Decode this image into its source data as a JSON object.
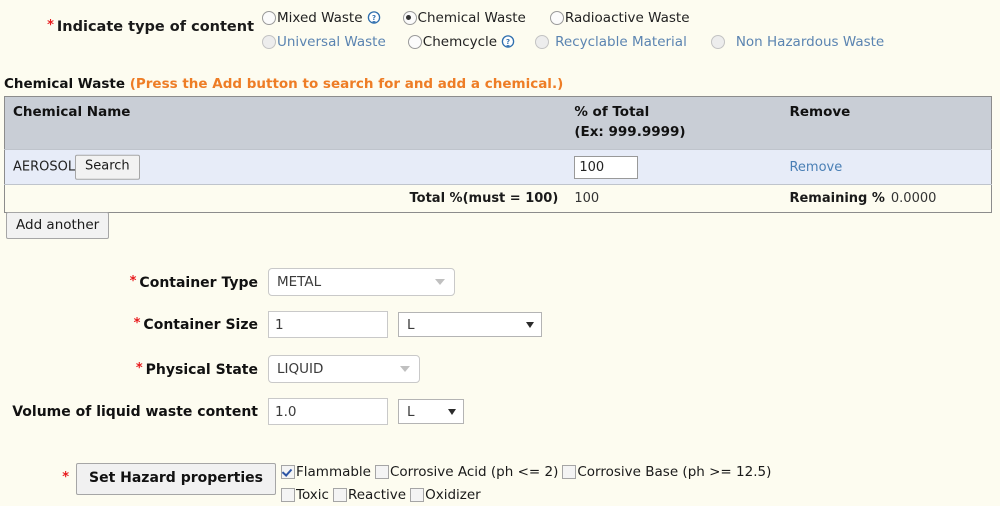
{
  "content_type": {
    "label": "Indicate type of content",
    "required": true,
    "options": [
      {
        "label": "Mixed Waste",
        "checked": false,
        "disabled": false,
        "help": true,
        "style": "normal"
      },
      {
        "label": "Chemical Waste",
        "checked": true,
        "disabled": false,
        "help": false,
        "style": "normal"
      },
      {
        "label": "Radioactive Waste",
        "checked": false,
        "disabled": false,
        "help": false,
        "style": "normal"
      },
      {
        "label": "Universal Waste",
        "checked": false,
        "disabled": true,
        "help": false,
        "style": "disabled"
      },
      {
        "label": "Chemcycle",
        "checked": false,
        "disabled": false,
        "help": true,
        "style": "normal"
      },
      {
        "label": "Recyclable Material",
        "checked": false,
        "disabled": true,
        "help": false,
        "style": "disabled"
      },
      {
        "label": "Non Hazardous Waste",
        "checked": false,
        "disabled": true,
        "help": false,
        "style": "disabled"
      }
    ]
  },
  "chemical_section": {
    "heading": "Chemical Waste",
    "hint": "(Press the Add button to search for and add a chemical.)",
    "columns": [
      "Chemical Name",
      "% of Total",
      "(Ex: 999.9999)",
      "Remove"
    ],
    "col_pct_line1": "% of Total",
    "col_pct_line2": "(Ex: 999.9999)",
    "rows": [
      {
        "chemical_name": "AEROSOL",
        "search_label": "Search",
        "percent_value": "100",
        "remove_label": "Remove"
      }
    ],
    "total_label": "Total %(must = 100)",
    "total_value": "100",
    "remaining_label": "Remaining %",
    "remaining_value": "0.0000",
    "add_another_label": "Add another"
  },
  "container": {
    "type_label": "Container Type",
    "type_value": "METAL",
    "size_label": "Container Size",
    "size_value": "1",
    "size_unit": "L",
    "state_label": "Physical State",
    "state_value": "LIQUID",
    "volume_label": "Volume of liquid waste content",
    "volume_value": "1.0",
    "volume_unit": "L"
  },
  "hazard": {
    "button_label": "Set Hazard properties",
    "required": true,
    "items": [
      {
        "label": "Flammable",
        "checked": true
      },
      {
        "label": "Corrosive Acid (ph <= 2)",
        "checked": false
      },
      {
        "label": "Corrosive Base (ph >= 12.5)",
        "checked": false
      },
      {
        "label": "Toxic",
        "checked": false
      },
      {
        "label": "Reactive",
        "checked": false
      },
      {
        "label": "Oxidizer",
        "checked": false
      }
    ]
  },
  "colors": {
    "page_bg": "#fdfcf0",
    "table_header_bg": "#c9ced6",
    "row_bg": "#e7ecf8",
    "hint_orange": "#ee7d26",
    "required_red": "#e8191c",
    "link_blue": "#4a7fb5"
  }
}
